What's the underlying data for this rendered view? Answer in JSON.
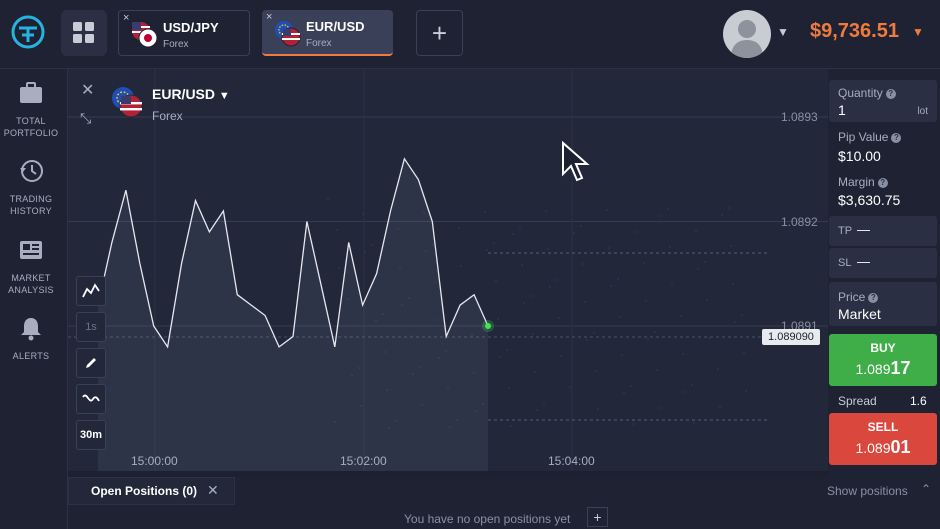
{
  "header": {
    "tabs": [
      {
        "pair": "USD/JPY",
        "type": "Forex",
        "close": "×"
      },
      {
        "pair": "EUR/USD",
        "type": "Forex",
        "close": "×"
      }
    ],
    "add_tab": "+",
    "balance": "$9,736.51",
    "accent_color": "#f07b3f"
  },
  "sidebar": {
    "items": [
      {
        "label1": "TOTAL",
        "label2": "PORTFOLIO",
        "icon": "briefcase-icon"
      },
      {
        "label1": "TRADING",
        "label2": "HISTORY",
        "icon": "history-icon"
      },
      {
        "label1": "MARKET",
        "label2": "ANALYSIS",
        "icon": "newspaper-icon"
      },
      {
        "label1": "ALERTS",
        "label2": "",
        "icon": "bell-icon"
      }
    ]
  },
  "chart": {
    "asset": "EUR/USD",
    "asset_type": "Forex",
    "tools": {
      "interval_seconds": "1s",
      "timeframe": "30m"
    },
    "current_price": "1.089090",
    "price_ticks": [
      "1.0893",
      "1.0892",
      "1.0891"
    ],
    "time_ticks": [
      "15:00:00",
      "15:02:00",
      "15:04:00"
    ]
  },
  "chart_data": {
    "type": "line",
    "xlabel": "",
    "ylabel": "",
    "x_ticks": [
      "15:00:00",
      "15:02:00",
      "15:04:00"
    ],
    "y_ticks": [
      1.0891,
      1.0892,
      1.0893
    ],
    "values": [
      1.08912,
      1.08918,
      1.08923,
      1.08916,
      1.0891,
      1.08908,
      1.08916,
      1.08922,
      1.08919,
      1.08921,
      1.08913,
      1.08912,
      1.08911,
      1.08908,
      1.08909,
      1.0892,
      1.08914,
      1.08908,
      1.08918,
      1.08912,
      1.08915,
      1.08921,
      1.08926,
      1.08924,
      1.0892,
      1.08909,
      1.08912,
      1.08913,
      1.0891
    ],
    "last_value": 1.08909
  },
  "panel": {
    "quantity_label": "Quantity",
    "quantity_value": "1",
    "quantity_unit": "lot",
    "pip_label": "Pip Value",
    "pip_value": "$10.00",
    "margin_label": "Margin",
    "margin_value": "$3,630.75",
    "tp_label": "TP",
    "tp_value": "—",
    "sl_label": "SL",
    "sl_value": "—",
    "price_label": "Price",
    "price_value": "Market",
    "buy_label": "BUY",
    "buy_price_main": "1.089",
    "buy_price_big": "17",
    "spread_label": "Spread",
    "spread_value": "1.6",
    "sell_label": "SELL",
    "sell_price_main": "1.089",
    "sell_price_big": "01"
  },
  "bottom": {
    "open_positions": "Open Positions",
    "open_count": "(0)",
    "show_positions": "Show positions",
    "empty_message": "You have no open positions yet",
    "add": "+"
  }
}
